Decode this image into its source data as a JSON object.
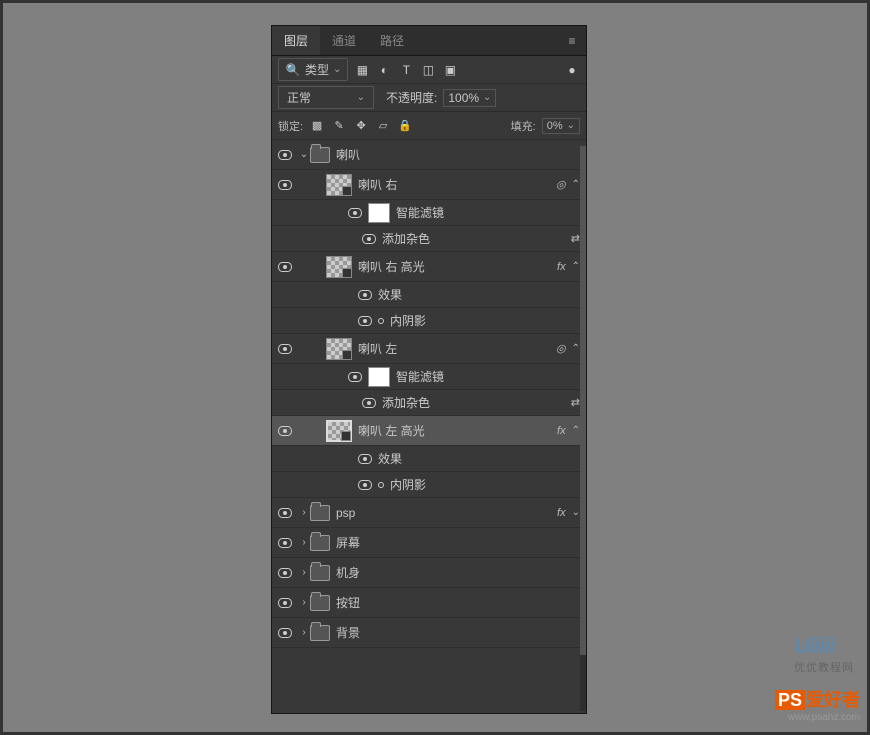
{
  "tabs": {
    "layers": "图层",
    "channels": "通道",
    "paths": "路径"
  },
  "filter": {
    "search_label": "类型"
  },
  "blend": {
    "mode": "正常",
    "opacity_label": "不透明度:",
    "opacity_value": "100%"
  },
  "lock": {
    "label": "锁定:",
    "fill_label": "填充:",
    "fill_value": "0%"
  },
  "layers": {
    "group_speaker": "喇叭",
    "speaker_right": "喇叭 右",
    "smart_filters": "智能滤镜",
    "add_noise": "添加杂色",
    "speaker_right_hl": "喇叭 右 高光",
    "effects": "效果",
    "inner_shadow": "内阴影",
    "speaker_left": "喇叭 左",
    "speaker_left_hl": "喇叭 左 高光",
    "psp": "psp",
    "screen": "屏幕",
    "body": "机身",
    "buttons": "按钮",
    "bg": "背景"
  },
  "fx_label": "fx",
  "wm1": {
    "main": "Uiiiii",
    "sub": "优优教程网"
  },
  "wm2": {
    "brand": "PS",
    "brand2": "爱好者",
    "url": "www.psahz.com"
  }
}
